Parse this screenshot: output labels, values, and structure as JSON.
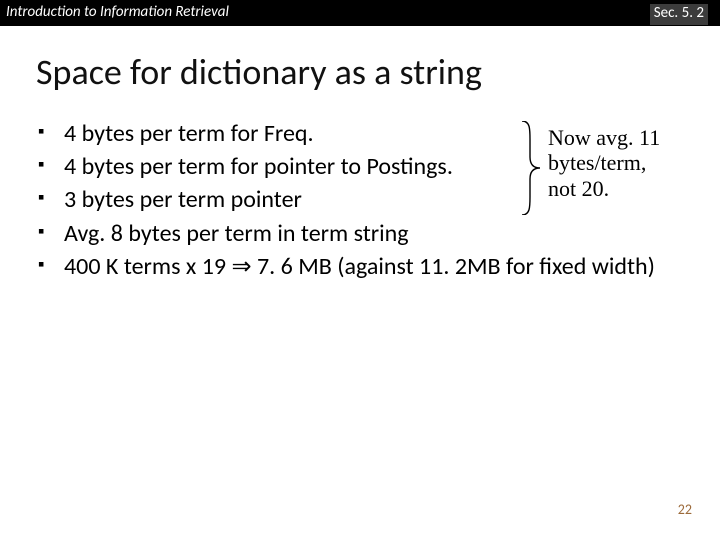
{
  "header": {
    "left": "Introduction to Information Retrieval",
    "right": "Sec. 5. 2"
  },
  "title": "Space for dictionary as a string",
  "bullets": [
    "4 bytes per term for Freq.",
    "4 bytes per term for pointer to Postings.",
    "3 bytes per term pointer",
    "Avg. 8 bytes per term in term string",
    "400 K terms x 19 ⇒ 7. 6 MB (against 11. 2MB for fixed width)"
  ],
  "annotation": {
    "line1": "Now avg. 11",
    "line2": "bytes/term,",
    "line3": "not 20."
  },
  "page_number": "22"
}
